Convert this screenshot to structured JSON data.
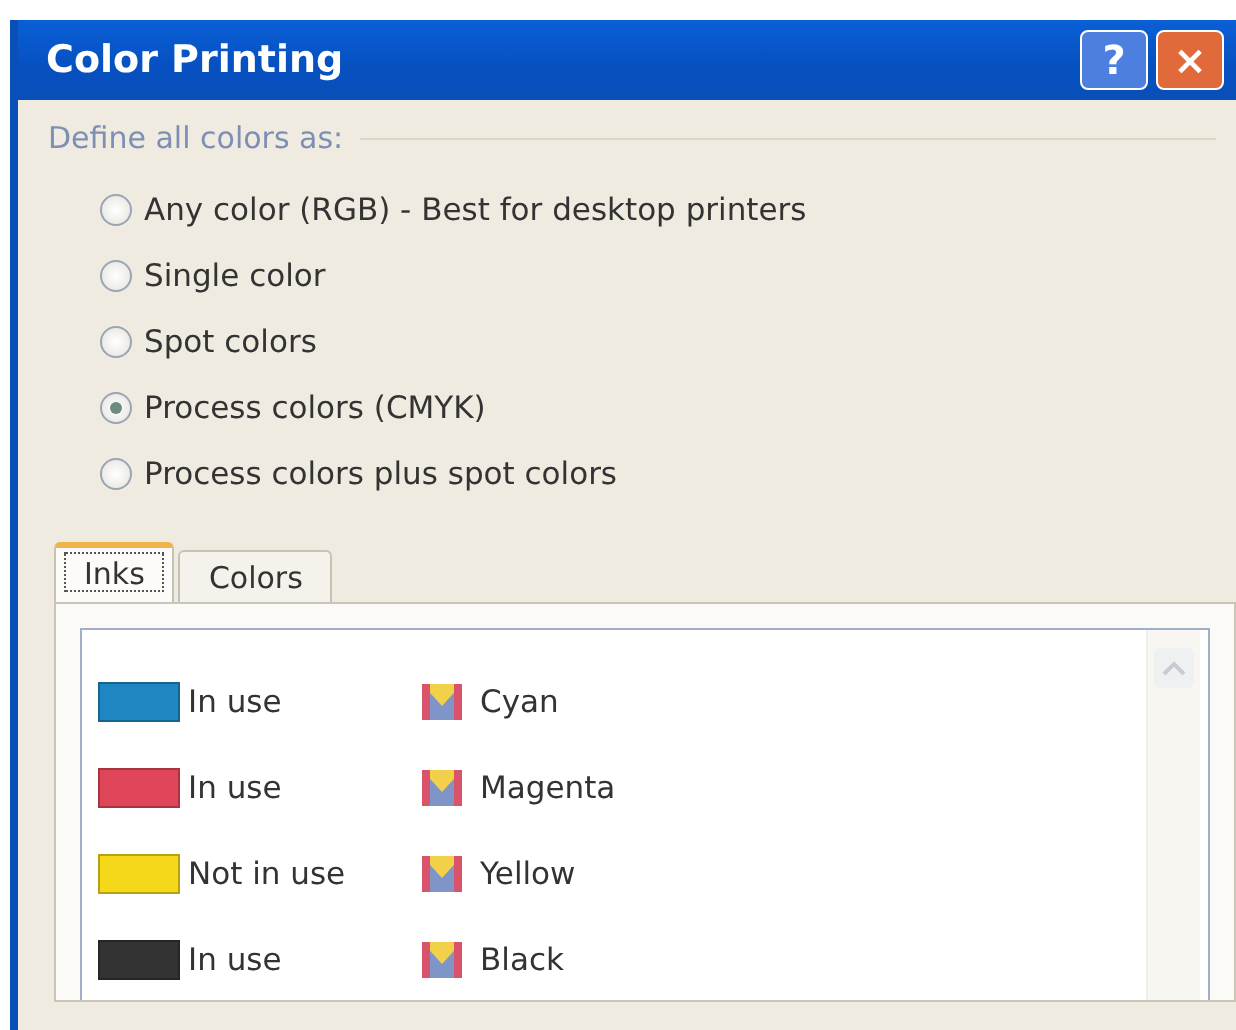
{
  "window": {
    "title": "Color Printing",
    "buttons": [
      "?",
      "×"
    ]
  },
  "color_mode": {
    "label": "Define all colors as:",
    "options": [
      {
        "label": "Any color (RGB) - Best for desktop printers",
        "selected": false
      },
      {
        "label": "Single color",
        "selected": false
      },
      {
        "label": "Spot colors",
        "selected": false
      },
      {
        "label": "Process colors (CMYK)",
        "selected": true
      },
      {
        "label": "Process colors plus spot colors",
        "selected": false
      }
    ]
  },
  "tabs": [
    {
      "label": "Inks",
      "selected": true
    },
    {
      "label": "Colors",
      "selected": false
    }
  ],
  "inks": [
    {
      "status": "In use",
      "name": "Cyan",
      "color": "#1e87c2"
    },
    {
      "status": "In use",
      "name": "Magenta",
      "color": "#e0465a"
    },
    {
      "status": "Not in use",
      "name": "Yellow",
      "color": "#f6d81a"
    },
    {
      "status": "In use",
      "name": "Black",
      "color": "#333333"
    }
  ]
}
